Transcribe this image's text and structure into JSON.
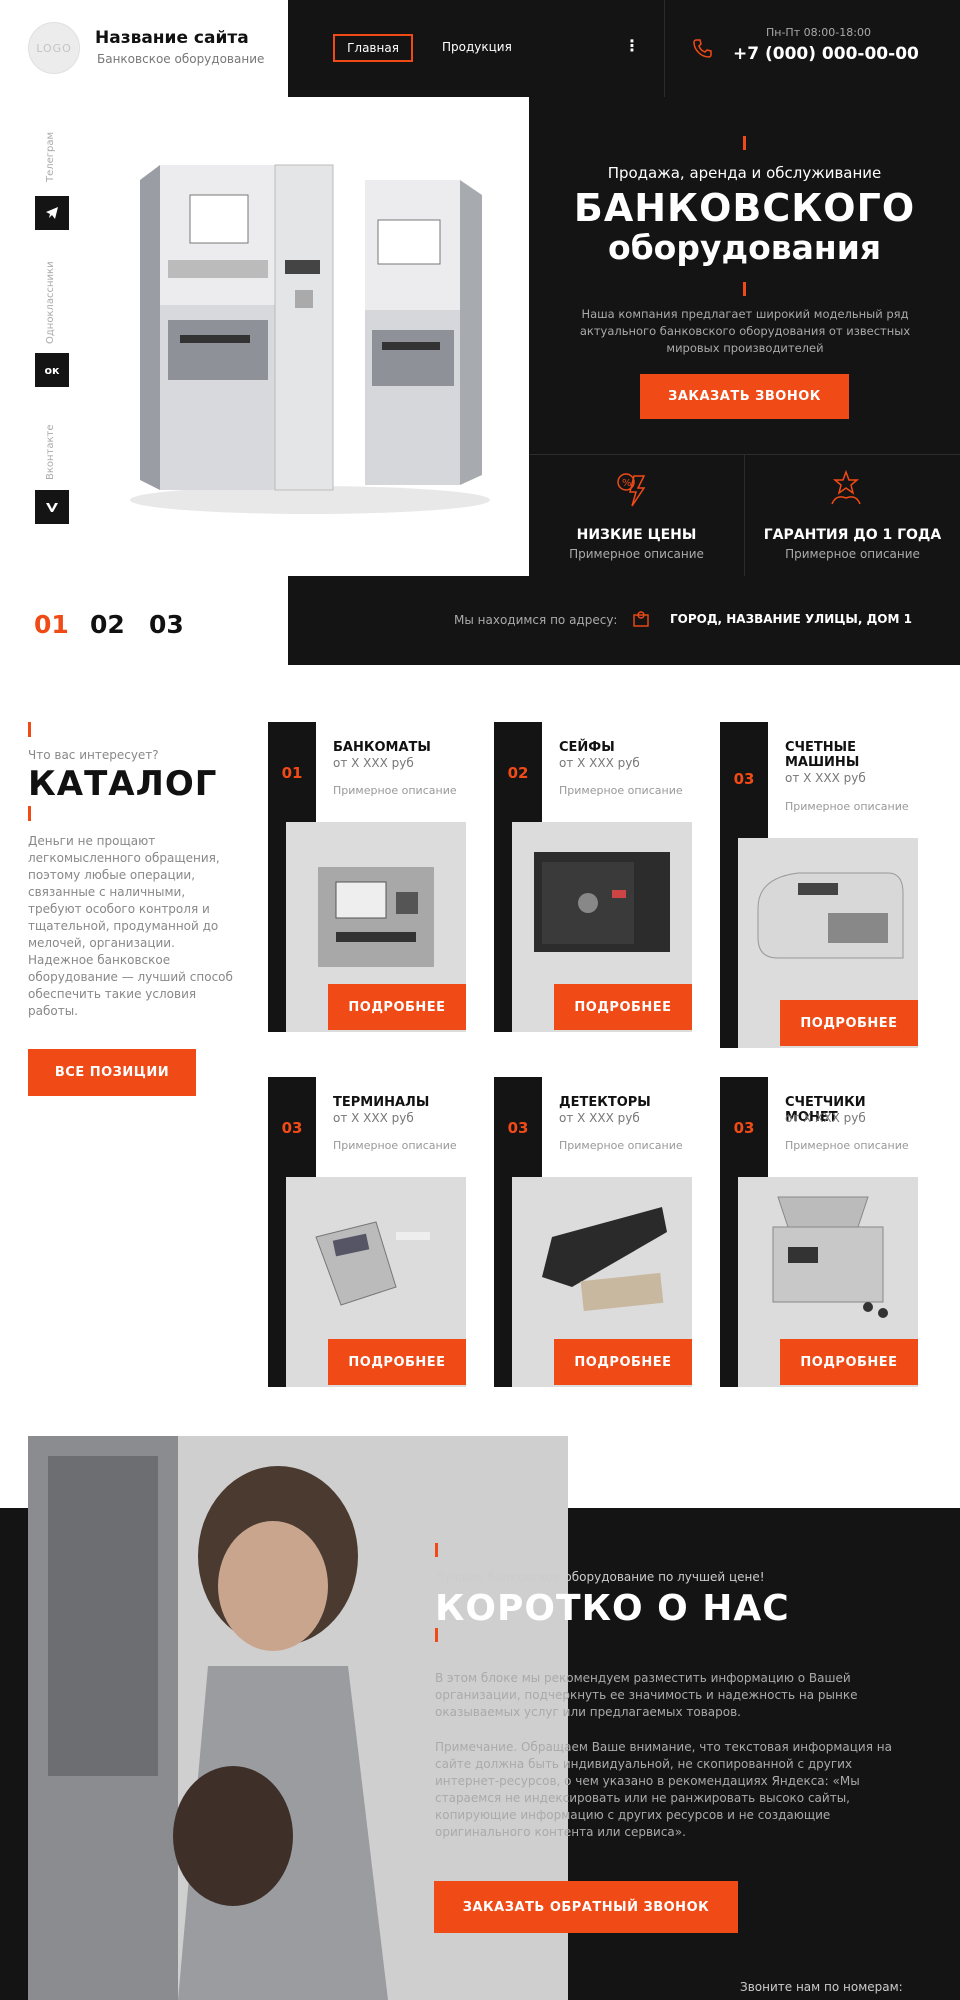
{
  "header": {
    "logo_text": "LOGO",
    "site_name": "Название сайта",
    "site_sub": "Банковское оборудование",
    "nav": [
      "Главная",
      "Продукция"
    ],
    "more_icon": "vertical-dots-icon",
    "hours": "Пн-Пт 08:00-18:00",
    "phone": "+7 (000) 000-00-00",
    "phone_icon": "phone-icon"
  },
  "social": [
    {
      "label": "Телеграм",
      "btn": "",
      "icon": "telegram-icon"
    },
    {
      "label": "Одноклассники",
      "btn": "ок",
      "icon": "odnoklassniki-icon"
    },
    {
      "label": "Вконтакте",
      "btn": "",
      "icon": "vk-icon"
    }
  ],
  "hero": {
    "pre": "Продажа, аренда и обслуживание",
    "title_1": "БАНКОВСКОГО",
    "title_2": "оборудования",
    "desc": "Наша компания предлагает широкий модельный ряд актуального банковского оборудования от известных мировых производителей",
    "button": "ЗАКАЗАТЬ ЗВОНОК",
    "features": [
      {
        "title": "НИЗКИЕ ЦЕНЫ",
        "sub": "Примерное описание",
        "icon": "low-price-icon"
      },
      {
        "title": "ГАРАНТИЯ ДО 1 ГОДА",
        "sub": "Примерное описание",
        "icon": "guarantee-icon"
      }
    ],
    "slides": [
      "01",
      "02",
      "03"
    ],
    "active_slide": "01"
  },
  "address": {
    "label": "Мы находимся по адресу:",
    "value": "ГОРОД, НАЗВАНИЕ УЛИЦЫ, ДОМ 1",
    "icon": "map-icon"
  },
  "catalog": {
    "pre": "Что вас интересует?",
    "title": "КАТАЛОГ",
    "desc": "Деньги не прощают легкомысленного обращения, поэтому любые операции, связанные с наличными, требуют особого контроля и тщательной, продуманной до мелочей, организации. Надежное банковское оборудование — лучший способ обеспечить такие условия работы.",
    "all_button": "ВСЕ ПОЗИЦИИ",
    "items": [
      {
        "num": "01",
        "name": "БАНКОМАТЫ",
        "price": "от Х ХХХ руб",
        "desc": "Примерное описание",
        "button": "ПОДРОБНЕЕ",
        "icon": "atm-image"
      },
      {
        "num": "02",
        "name": "СЕЙФЫ",
        "price": "от Х ХХХ руб",
        "desc": "Примерное описание",
        "button": "ПОДРОБНЕЕ",
        "icon": "safe-image"
      },
      {
        "num": "03",
        "name": "СЧЕТНЫЕ МАШИНЫ",
        "price": "от Х ХХХ руб",
        "desc": "Примерное описание",
        "button": "ПОДРОБНЕЕ",
        "icon": "counting-machine-image"
      },
      {
        "num": "03",
        "name": "ТЕРМИНАЛЫ",
        "price": "от Х ХХХ руб",
        "desc": "Примерное описание",
        "button": "ПОДРОБНЕЕ",
        "icon": "terminal-image"
      },
      {
        "num": "03",
        "name": "ДЕТЕКТОРЫ",
        "price": "от Х ХХХ руб",
        "desc": "Примерное описание",
        "button": "ПОДРОБНЕЕ",
        "icon": "detector-image"
      },
      {
        "num": "03",
        "name": "СЧЕТЧИКИ МОНЕТ",
        "price": "от Х ХХХ руб",
        "desc": "Примерное описание",
        "button": "ПОДРОБНЕЕ",
        "icon": "coin-counter-image"
      }
    ]
  },
  "about": {
    "pre": "Лучшее банковское оборудование по лучшей цене!",
    "title": "КОРОТКО О НАС",
    "p1": "В этом блоке мы рекомендуем разместить информацию о Вашей организации, подчеркнуть ее значимость и надежность на рынке оказываемых услуг или предлагаемых товаров.",
    "p2": "Примечание. Обращаем Ваше внимание, что текстовая информация на сайте должна быть индивидуальной, не скопированной с других интернет-ресурсов, о чем указано в рекомендациях Яндекса: «Мы стараемся не индексировать или не ранжировать высоко сайты, копирующие информацию с других ресурсов и не создающие оригинального контента или сервиса».",
    "button": "ЗАКАЗАТЬ ОБРАТНЫЙ ЗВОНОК",
    "call_label": "Звоните нам по номерам:"
  },
  "colors": {
    "accent": "#f04a17",
    "dark": "#141414"
  }
}
